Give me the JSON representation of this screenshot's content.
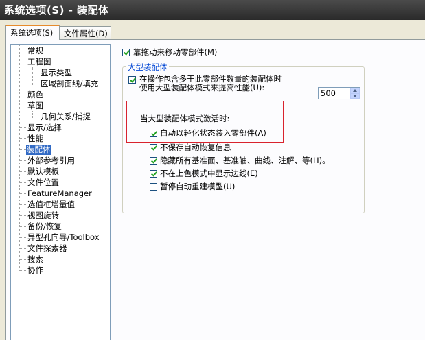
{
  "window": {
    "title": "系统选项(S) - 装配体"
  },
  "tabs": [
    {
      "label": "系统选项(S)"
    },
    {
      "label": "文件属性(D)"
    }
  ],
  "tree": {
    "items": [
      "常规",
      "工程图",
      "显示类型",
      "区域剖面线/填充",
      "颜色",
      "草图",
      "几何关系/捕捉",
      "显示/选择",
      "性能",
      "装配体",
      "外部参考引用",
      "默认模板",
      "文件位置",
      "FeatureManager",
      "选值框增量值",
      "视图旋转",
      "备份/恢复",
      "异型孔向导/Toolbox",
      "文件探索器",
      "搜索",
      "协作"
    ]
  },
  "options": {
    "drag_move": "靠拖动来移动零部件(M)",
    "large_group_title": "大型装配体",
    "use_large_mode_1": "在操作包含多于此零部件数量的装配体时",
    "use_large_mode_2": "使用大型装配体模式来提高性能(U):",
    "threshold_value": "500",
    "when_active": "当大型装配体模式激活时:",
    "auto_lightweight": "自动以轻化状态装入零部件(A)",
    "no_save_recover": "不保存自动恢复信息",
    "hide_planes": "隐藏所有基准面、基准轴、曲线、注解、等(H)。",
    "no_edges_shaded": "不在上色模式中显示边线(E)",
    "suspend_rebuild": "暂停自动重建模型(U)"
  }
}
